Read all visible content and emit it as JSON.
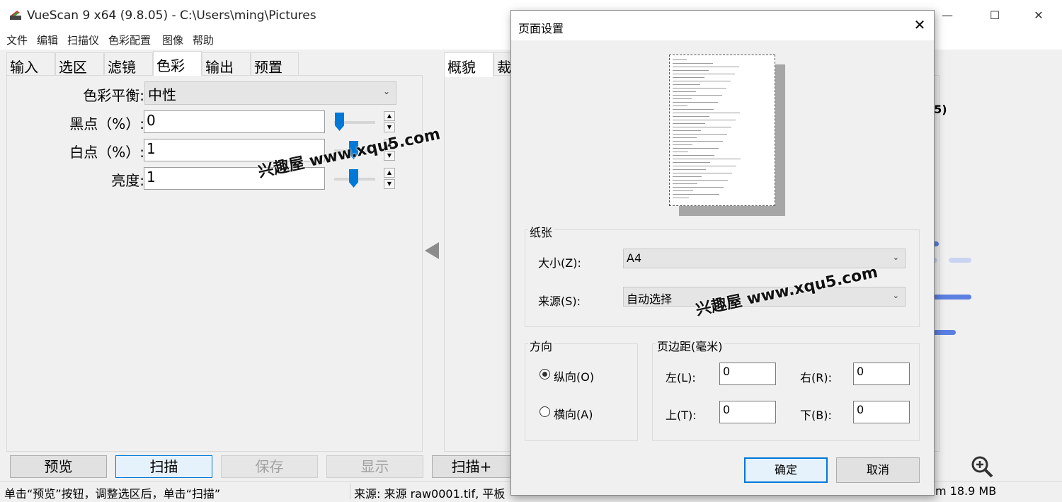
{
  "window": {
    "title": "VueScan 9 x64 (9.8.05) - C:\\Users\\ming\\Pictures",
    "minimize": "—",
    "maximize": "☐",
    "close": "✕"
  },
  "menu": [
    "文件",
    "编辑",
    "扫描仪",
    "色彩配置",
    "图像",
    "帮助"
  ],
  "left_tabs": [
    "输入",
    "选区",
    "滤镜",
    "色彩",
    "输出",
    "预置"
  ],
  "left_active_tab": "色彩",
  "right_tabs": [
    "概貌",
    "裁"
  ],
  "color_panel": {
    "color_balance_label": "色彩平衡:",
    "color_balance_value": "中性",
    "black_point_label": "黑点（%）:",
    "black_point_value": "0",
    "white_point_label": "白点（%）:",
    "white_point_value": "1",
    "brightness_label": "亮度:",
    "brightness_value": "1"
  },
  "right_partial_text": "05)",
  "bottom_buttons": {
    "preview": "预览",
    "scan": "扫描",
    "save": "保存",
    "show": "显示",
    "scan_plus": "扫描+"
  },
  "status": {
    "hint": "单击“预览”按钮，调整选区后，单击“扫描”",
    "source": "来源: 来源 raw0001.tif, 平板",
    "size": "m 18.9 MB"
  },
  "dialog": {
    "title": "页面设置",
    "paper_group": "纸张",
    "size_label": "大小(Z):",
    "size_value": "A4",
    "source_label": "来源(S):",
    "source_value": "自动选择",
    "orientation_group": "方向",
    "portrait_label": "纵向(O)",
    "landscape_label": "横向(A)",
    "portrait_checked": true,
    "margins_group": "页边距(毫米)",
    "left_label": "左(L):",
    "left_value": "0",
    "right_label": "右(R):",
    "right_value": "0",
    "top_label": "上(T):",
    "top_value": "0",
    "bottom_label": "下(B):",
    "bottom_value": "0",
    "ok": "确定",
    "cancel": "取消"
  },
  "watermark": "兴趣屋 www.xqu5.com",
  "colors": {
    "accent": "#0078d7",
    "bar": "#5b7fe0",
    "bar_light": "#c9d4f2"
  }
}
